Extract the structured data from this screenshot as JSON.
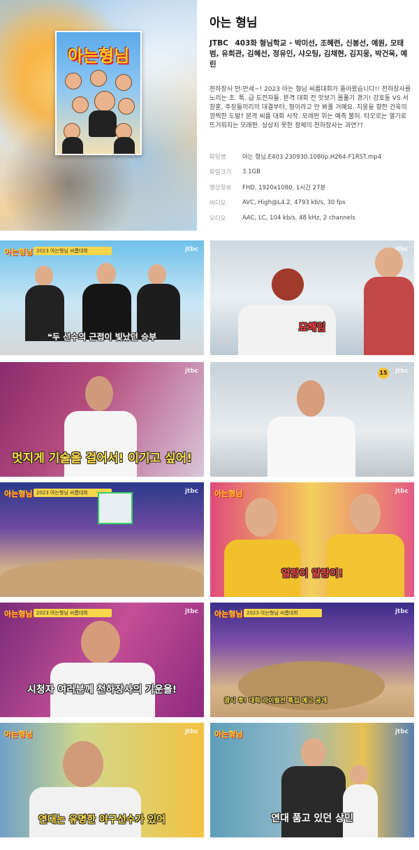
{
  "header": {
    "title": "아는 형님",
    "poster_title": "아는형님",
    "channel": "JTBC",
    "episode_line": "403화 형님학교 - 박미선, 조혜련, 신봉선, 예원, 모태범, 유희관, 김혜선, 정유인, 샤오팅, 김채현, 김지웅, 박건욱, 예린",
    "description": "천하장사 만-만세~! 2023 아는 형님 씨름대회가 돌아왔습니다!! 천하장사를 노리는 초. 특. 급 도전자들. 본격 대회 전 맛보기 몸풀기 경기! 강호동 VS 서장훈, 주장들끼리의 대결부터, 형이라고 안 봐줄 거예요. 지옹을 향한 건욱의 깜찍한 도발? 본격 씨름 대회 시작. 모래판 위는 예측 불허. 타오르는 열기로 뜨거워지는 모래판. 상상치 못한 정체의 천하장사는 과연??"
  },
  "meta": [
    {
      "key": "파일명",
      "value": "아는 형님.E403.230930.1080p.H264-F1RST.mp4"
    },
    {
      "key": "파일크기",
      "value": "3.1GB"
    },
    {
      "key": "영상정보",
      "value": "FHD, 1920x1080, 1시간 27분"
    },
    {
      "key": "비디오",
      "value": "AVC, High@L4.2, 4793 kb/s, 30 fps"
    },
    {
      "key": "오디오",
      "value": "AAC, LC, 104 kb/s, 48 kHz, 2 channels"
    }
  ],
  "thumbs": {
    "logo": "아는형님",
    "network": "jtbc",
    "rating": "15",
    "banner": "2023 아는형님 씨름대회",
    "captions": [
      "❝두 선수의 근접이 빛났던 승부",
      "묘해임",
      "멋지게 기술을 걸어서! 이기고 싶어!",
      "",
      "",
      "얼랑이 알랑이!",
      "시청자 여러분께 천하장사의 기운을!",
      "광시 후! 대학 라이벌전 특집 예고 공개",
      "연대는 유명한 야구선수가 있어",
      "연대 품고 있던 상민"
    ]
  },
  "colors": {
    "gold": "#ffd12b",
    "caption_yellow": "#ffe14a",
    "meta_key": "#999999"
  }
}
